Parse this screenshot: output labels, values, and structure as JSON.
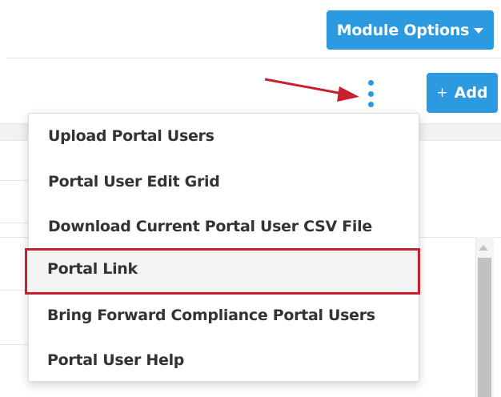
{
  "header": {
    "module_options_label": "Module Options"
  },
  "toolbar": {
    "add_plus": "+",
    "add_label": "Add"
  },
  "dropdown": {
    "items": [
      {
        "label": "Upload Portal Users"
      },
      {
        "label": "Portal User Edit Grid"
      },
      {
        "label": "Download Current Portal User CSV File"
      },
      {
        "label": "Portal Link",
        "highlighted": true
      },
      {
        "label": "Bring Forward Compliance Portal Users"
      },
      {
        "label": "Portal User Help"
      }
    ]
  },
  "colors": {
    "accent": "#2b9ae0",
    "annotation": "#c8202f"
  },
  "icons": {
    "more": "vertical-ellipsis-icon",
    "caret": "caret-down-icon",
    "annotation": "red-arrow-annotation"
  }
}
